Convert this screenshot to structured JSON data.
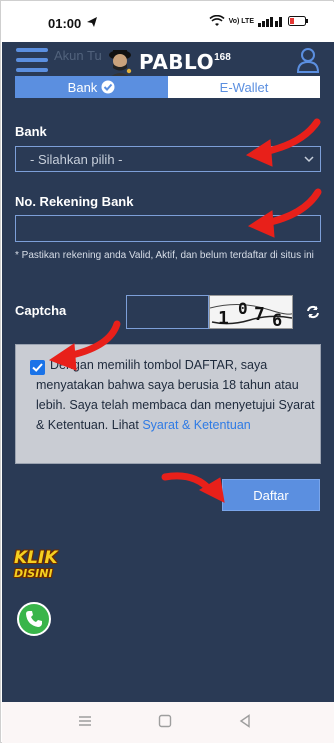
{
  "status_bar": {
    "time": "01:00",
    "network_label": "Vo) LTE"
  },
  "header": {
    "ghost_text": "Akun Tu",
    "logo_text": "PABLO",
    "logo_sup": "168"
  },
  "tabs": {
    "bank": "Bank",
    "ewallet": "E-Wallet"
  },
  "form": {
    "bank_label": "Bank",
    "bank_select_value": "- Silahkan pilih -",
    "account_label": "No. Rekening Bank",
    "account_hint": "* Pastikan rekening anda Valid, Aktif, dan belum terdaftar di situs ini",
    "captcha_label": "Captcha",
    "captcha_code": "1076",
    "agreement_checked": true,
    "agreement_text": "Dengan memilih tombol DAFTAR, saya menyatakan bahwa saya berusia 18 tahun atau lebih. Saya telah membaca dan menyetujui Syarat & Ketentuan. Lihat",
    "agreement_link": "Syarat & Ketentuan",
    "submit_label": "Daftar"
  },
  "floating": {
    "klik_line1": "KLIK",
    "klik_line2": "DISINI"
  },
  "colors": {
    "background": "#2a3a55",
    "accent": "#5b8fe0",
    "arrow": "#e8201a",
    "whatsapp": "#39b54a"
  },
  "icons": [
    "menu-icon",
    "user-icon",
    "check-icon",
    "chevron-down-icon",
    "refresh-icon",
    "phone-icon",
    "send-icon",
    "wifi-icon",
    "signal-icon",
    "battery-icon"
  ]
}
